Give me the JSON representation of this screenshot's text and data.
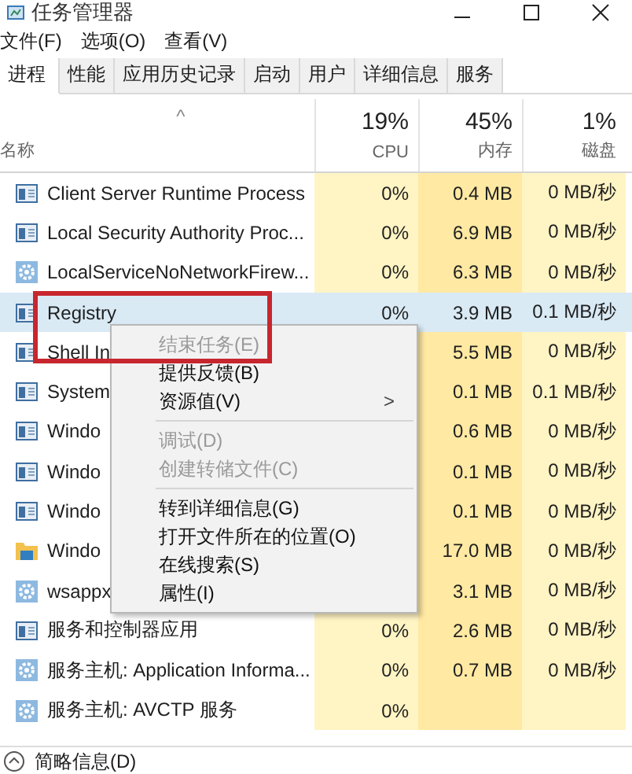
{
  "window": {
    "title": "任务管理器"
  },
  "menu": [
    "文件(F)",
    "选项(O)",
    "查看(V)"
  ],
  "tabs": [
    {
      "label": "进程",
      "selected": true
    },
    {
      "label": "性能",
      "selected": false
    },
    {
      "label": "应用历史记录",
      "selected": false
    },
    {
      "label": "启动",
      "selected": false
    },
    {
      "label": "用户",
      "selected": false
    },
    {
      "label": "详细信息",
      "selected": false
    },
    {
      "label": "服务",
      "selected": false
    }
  ],
  "table": {
    "sort_arrow": "^",
    "columns": [
      {
        "label": "名称"
      },
      {
        "label": "CPU",
        "percent": "19%"
      },
      {
        "label": "内存",
        "percent": "45%"
      },
      {
        "label": "磁盘",
        "percent": "1%"
      }
    ],
    "rows": [
      {
        "kind": "window",
        "name": "Client Server Runtime Process",
        "cpu": "0%",
        "memory": "0.4 MB",
        "disk": "0 MB/秒",
        "selected": false
      },
      {
        "kind": "window",
        "name": "Local Security Authority Proc...",
        "cpu": "0%",
        "memory": "6.9 MB",
        "disk": "0 MB/秒",
        "selected": false
      },
      {
        "kind": "gear",
        "name": "LocalServiceNoNetworkFirew...",
        "cpu": "0%",
        "memory": "6.3 MB",
        "disk": "0 MB/秒",
        "selected": false
      },
      {
        "kind": "window",
        "name": "Registry",
        "cpu": "0%",
        "memory": "3.9 MB",
        "disk": "0.1 MB/秒",
        "selected": true
      },
      {
        "kind": "window",
        "name": "Shell In",
        "memory": "5.5 MB",
        "disk": "0 MB/秒",
        "selected": false
      },
      {
        "kind": "window",
        "name": "System",
        "memory": "0.1 MB",
        "disk": "0.1 MB/秒",
        "selected": false
      },
      {
        "kind": "window",
        "name": "Windo",
        "memory": "0.6 MB",
        "disk": "0 MB/秒",
        "selected": false
      },
      {
        "kind": "window",
        "name": "Windo",
        "memory": "0.1 MB",
        "disk": "0 MB/秒",
        "selected": false
      },
      {
        "kind": "window",
        "name": "Windo",
        "memory": "0.1 MB",
        "disk": "0 MB/秒",
        "selected": false
      },
      {
        "kind": "folder",
        "name": "Windo",
        "memory": "17.0 MB",
        "disk": "0 MB/秒",
        "selected": false
      },
      {
        "kind": "gear",
        "name": "wsappx",
        "memory": "3.1 MB",
        "disk": "0 MB/秒",
        "selected": false
      },
      {
        "kind": "window",
        "name": "服务和控制器应用",
        "cpu": "0%",
        "memory": "2.6 MB",
        "disk": "0 MB/秒",
        "selected": false
      },
      {
        "kind": "gear",
        "name": "服务主机: Application Informa...",
        "cpu": "0%",
        "memory": "0.7 MB",
        "disk": "0 MB/秒",
        "selected": false
      },
      {
        "kind": "gear",
        "name": "服务主机: AVCTP 服务",
        "cpu": "0%",
        "selected": false
      }
    ]
  },
  "context_menu": {
    "items": [
      {
        "kind": "item",
        "label": "结束任务(E)",
        "disabled": true
      },
      {
        "kind": "item",
        "label": "提供反馈(B)",
        "disabled": false
      },
      {
        "kind": "submenu",
        "label": "资源值(V)",
        "arrow": ">",
        "disabled": false
      },
      {
        "kind": "separator"
      },
      {
        "kind": "item",
        "label": "调试(D)",
        "disabled": true
      },
      {
        "kind": "item",
        "label": "创建转储文件(C)",
        "disabled": true
      },
      {
        "kind": "separator"
      },
      {
        "kind": "item",
        "label": "转到详细信息(G)",
        "disabled": false
      },
      {
        "kind": "item",
        "label": "打开文件所在的位置(O)",
        "disabled": false
      },
      {
        "kind": "item",
        "label": "在线搜索(S)",
        "disabled": false
      },
      {
        "kind": "item",
        "label": "属性(I)",
        "disabled": false
      }
    ]
  },
  "annotation_frame": true,
  "footer": {
    "label": "简略信息(D)"
  }
}
